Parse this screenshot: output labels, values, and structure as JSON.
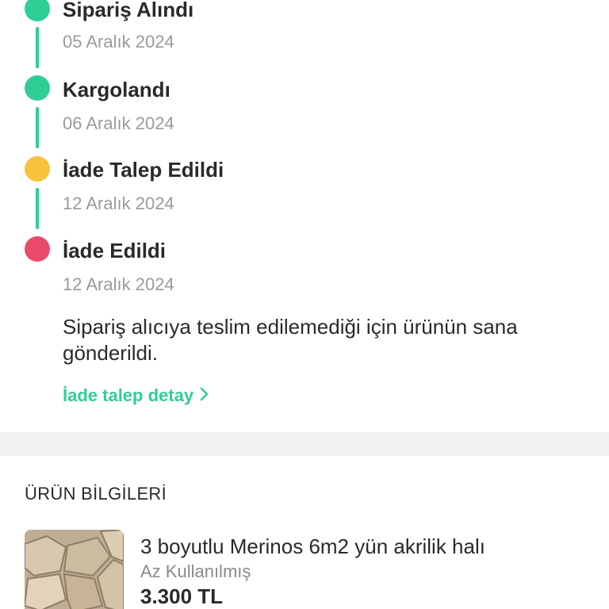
{
  "timeline": {
    "steps": [
      {
        "title": "Sipariş Alındı",
        "date": "05 Aralık 2024",
        "status_color": "#2ecf94"
      },
      {
        "title": "Kargolandı",
        "date": "06 Aralık 2024",
        "status_color": "#2ecf94"
      },
      {
        "title": "İade Talep Edildi",
        "date": "12 Aralık 2024",
        "status_color": "#f8c23a"
      },
      {
        "title": "İade Edildi",
        "date": "12 Aralık 2024",
        "status_color": "#ea4a6a"
      }
    ],
    "line_color": "#2ecf94",
    "note": "Sipariş alıcıya teslim edilemediği için ürünün sana gönderildi.",
    "detail_link": "İade talep detay",
    "detail_icon": "chevron-right-icon"
  },
  "product_section": {
    "title": "ÜRÜN BİLGİLERİ",
    "product": {
      "name": "3 boyutlu Merinos 6m2 yün akrilik halı",
      "condition": "Az Kullanılmış",
      "price": "3.300 TL",
      "image": "stone-pattern-rug-image"
    }
  },
  "colors": {
    "accent": "#2ecf94",
    "warning": "#f8c23a",
    "danger": "#ea4a6a",
    "separator": "#f1f1f1"
  }
}
